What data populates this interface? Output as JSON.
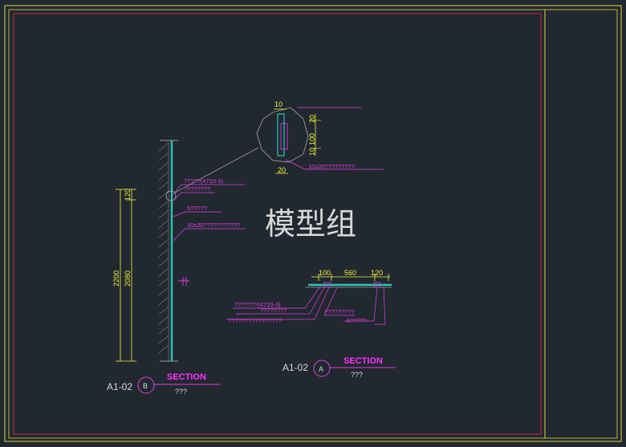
{
  "watermark": "模型组",
  "colors": {
    "background": "#212830",
    "frame": "#dddd40",
    "border": "#cc2a3a",
    "dimension": "#f2f23a",
    "annotation": "#e040e0",
    "section_title": "#ff30ff",
    "glass": "#2ec4b6",
    "label": "#d8d8d8"
  },
  "detail_top": {
    "dims": [
      "10",
      "20",
      "100",
      "10",
      "20"
    ],
    "note": "10x20?????????"
  },
  "section_b": {
    "annotations": [
      "?????(4710-3)",
      "????????",
      "5?????",
      "10x20???????????"
    ],
    "dims": [
      "120",
      "2200",
      "2080"
    ],
    "id": "A1-02",
    "bubble": "B",
    "title": "SECTION",
    "subtitle": "???"
  },
  "section_a": {
    "dims": [
      "100",
      "560",
      "120"
    ],
    "annotations": [
      "???????(4710-3)",
      "????????",
      "?????????",
      "????????????????",
      "5?????"
    ],
    "id": "A1-02",
    "bubble": "A",
    "title": "SECTION",
    "subtitle": "???"
  }
}
